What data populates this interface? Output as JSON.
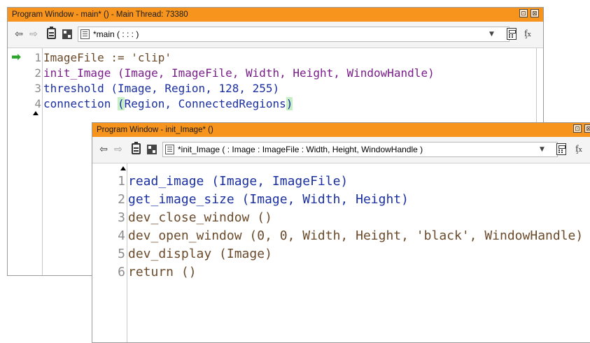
{
  "main_window": {
    "title": "Program Window - main* () - Main Thread: 73380",
    "toolbar": {
      "back_icon": "arrow-left-icon",
      "forward_icon": "arrow-right-icon",
      "procedure_label": "*main ( : : : )"
    },
    "code_lines": [
      {
        "num": "1",
        "text": "ImageFile := 'clip'"
      },
      {
        "num": "2",
        "text": "init_Image (Image, ImageFile, Width, Height, WindowHandle)"
      },
      {
        "num": "3",
        "text": "threshold (Image, Region, 128, 255)"
      },
      {
        "num": "4",
        "text_a": "connection ",
        "text_b": "(",
        "text_c": "Region, ConnectedRegions",
        "text_d": ")"
      }
    ]
  },
  "sub_window": {
    "title": "Program Window - init_Image* ()",
    "toolbar": {
      "procedure_label": "*init_Image ( : Image : ImageFile : Width, Height, WindowHandle )"
    },
    "code_lines": [
      {
        "num": "1",
        "text": "read_image (Image, ImageFile)"
      },
      {
        "num": "2",
        "text": "get_image_size (Image, Width, Height)"
      },
      {
        "num": "3",
        "text": "dev_close_window ()"
      },
      {
        "num": "4",
        "text": "dev_open_window (0, 0, Width, Height, 'black', WindowHandle)"
      },
      {
        "num": "5",
        "text": "dev_display (Image)"
      },
      {
        "num": "6",
        "text": "return ()"
      }
    ]
  },
  "window_buttons": {
    "restore": "⊡",
    "close": "⊠"
  },
  "colors": {
    "titlebar": "#f7941d",
    "breakpoint_arrow": "#2aa52a"
  }
}
